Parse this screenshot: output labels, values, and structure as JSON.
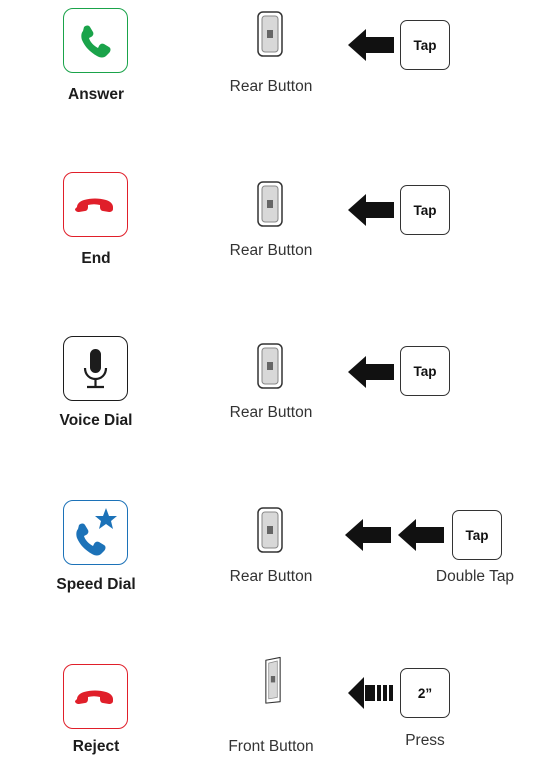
{
  "rows": [
    {
      "label": "Answer",
      "icon": "phone-answer-icon",
      "device": "Rear Button",
      "action": "Tap"
    },
    {
      "label": "End",
      "icon": "phone-end-icon",
      "device": "Rear Button",
      "action": "Tap"
    },
    {
      "label": "Voice Dial",
      "icon": "microphone-icon",
      "device": "Rear Button",
      "action": "Tap"
    },
    {
      "label": "Speed Dial",
      "icon": "phone-star-icon",
      "device": "Rear Button",
      "action": "Tap",
      "action_caption": "Double Tap"
    },
    {
      "label": "Reject",
      "icon": "phone-end-icon",
      "device": "Front Button",
      "action": "2”",
      "action_caption": "Press"
    }
  ],
  "colors": {
    "answer": "#1aa34a",
    "end": "#e01f2a",
    "voice": "#1c1c1c",
    "speed": "#1c72b8",
    "reject": "#e01f2a"
  }
}
